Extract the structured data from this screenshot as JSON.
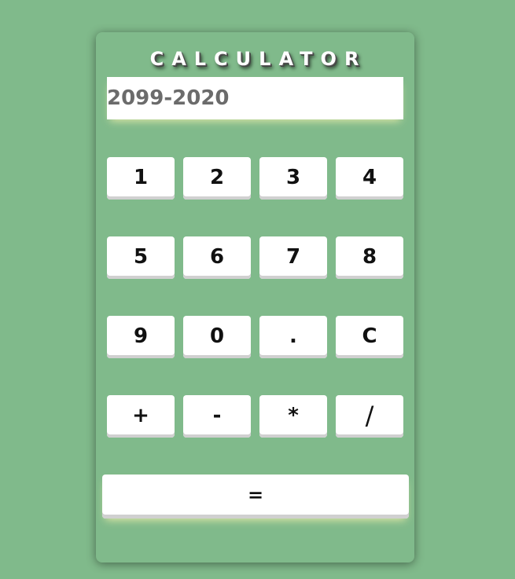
{
  "app": {
    "title": "CALCULATOR",
    "display_value": "2099-2020"
  },
  "keypad": {
    "rows": [
      [
        "1",
        "2",
        "3",
        "4"
      ],
      [
        "5",
        "6",
        "7",
        "8"
      ],
      [
        "9",
        "0",
        ".",
        "C"
      ],
      [
        "+",
        "-",
        "*",
        "/"
      ]
    ],
    "equals_label": "="
  },
  "colors": {
    "background": "#80ba8b",
    "key_face": "#ffffff",
    "key_shadow": "#d0d0d0",
    "display_text": "#6b6b6b"
  }
}
